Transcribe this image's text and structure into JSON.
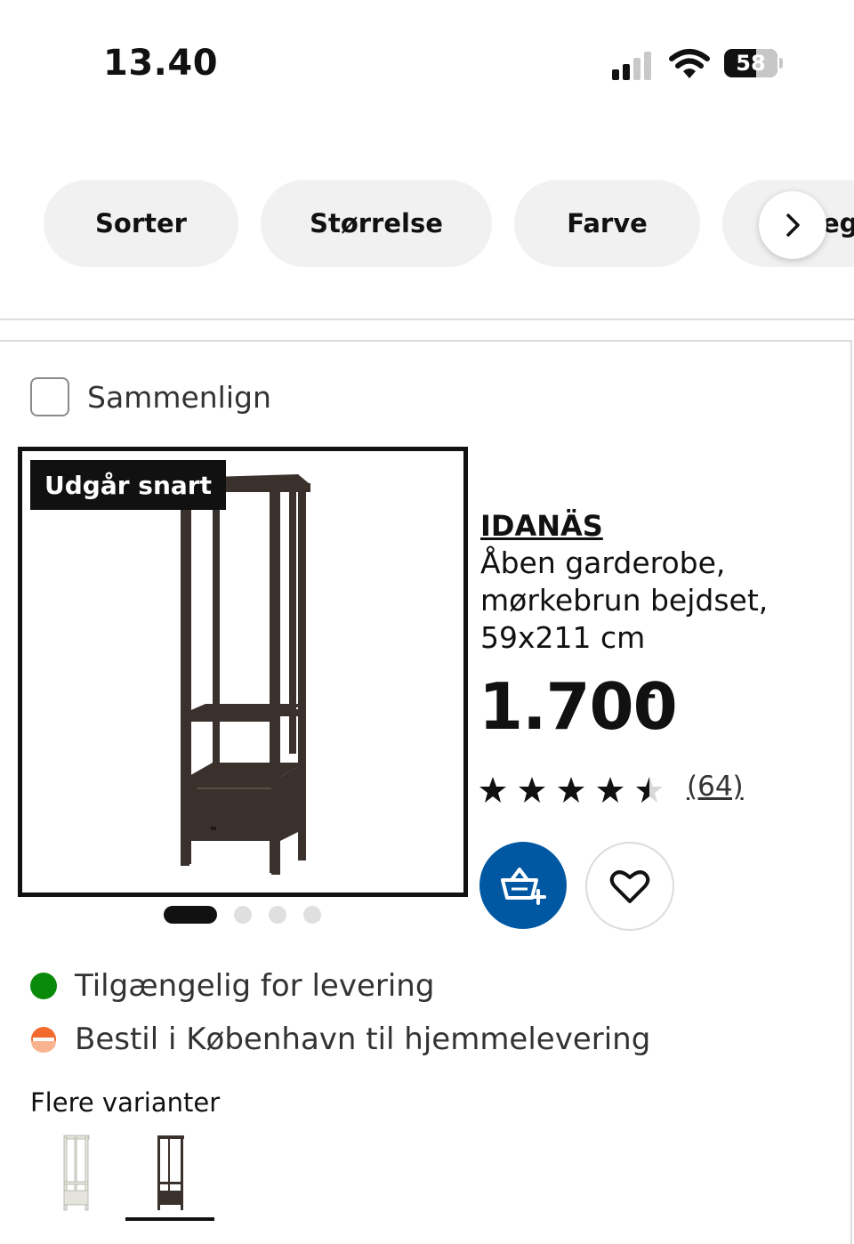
{
  "status_bar": {
    "time": "13.40",
    "battery": "58",
    "battery_level": 0.58,
    "icons": [
      "signal-icon",
      "wifi-icon",
      "battery-icon"
    ]
  },
  "filters": {
    "items": [
      {
        "label": "Sorter"
      },
      {
        "label": "Størrelse"
      },
      {
        "label": "Farve"
      },
      {
        "label": "eg"
      }
    ],
    "next_icon": "chevron-right-icon"
  },
  "product": {
    "compare_label": "Sammenlign",
    "compare_checked": false,
    "badge": "Udgår snart",
    "name": "IDANÄS",
    "description": "Åben garderobe, mørkebrun bejdset, 59x211 cm",
    "price": "1.700",
    "price_suffix": ".-",
    "rating": 4.5,
    "reviews": "(64)",
    "image_count": 4,
    "active_image": 1,
    "cart_icon": "add-to-cart-icon",
    "favorite_icon": "heart-icon"
  },
  "availability": [
    {
      "text": "Tilgængelig for levering",
      "status": "available"
    },
    {
      "text": "Bestil i København til hjemmelevering",
      "status": "partial"
    }
  ],
  "variants": {
    "label": "Flere varianter",
    "items": [
      {
        "color": "white",
        "selected": false
      },
      {
        "color": "dark-brown",
        "selected": true
      }
    ]
  },
  "colors": {
    "accent_blue": "#0058a3",
    "available_green": "#0a8a0a",
    "partial_orange": "#f26a2e",
    "badge_bg": "#111111",
    "pill_bg": "#f1f1f1"
  }
}
